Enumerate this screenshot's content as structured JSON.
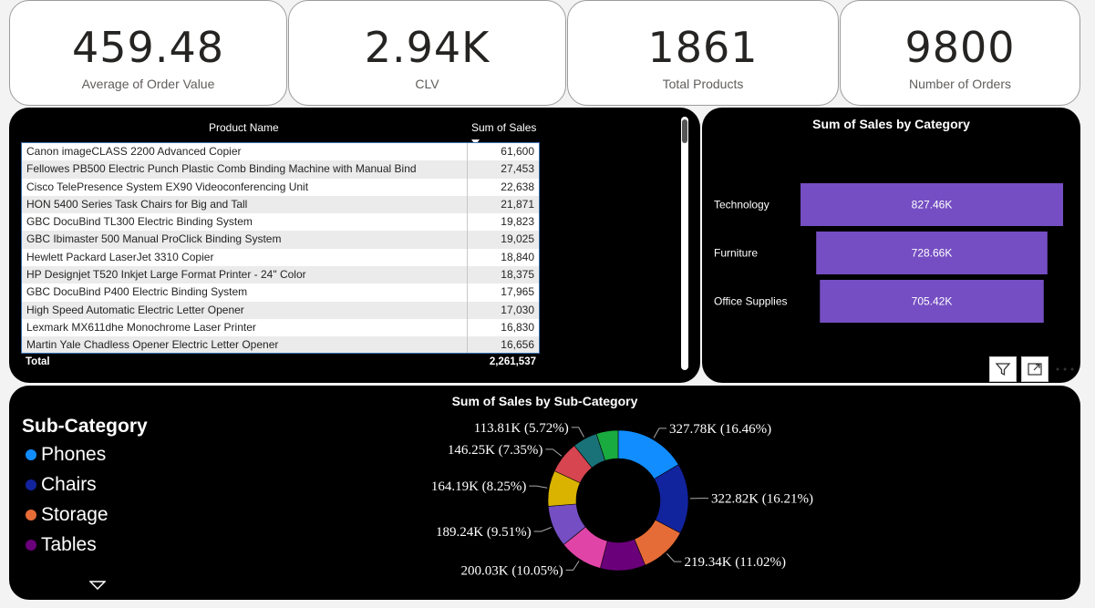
{
  "kpis": [
    {
      "value": "459.48",
      "label": "Average of Order Value"
    },
    {
      "value": "2.94K",
      "label": "CLV"
    },
    {
      "value": "1861",
      "label": "Total Products"
    },
    {
      "value": "9800",
      "label": "Number of Orders"
    }
  ],
  "table": {
    "col1": "Product Name",
    "col2": "Sum of Sales",
    "rows": [
      {
        "name": "Canon imageCLASS 2200 Advanced Copier",
        "sales": "61,600"
      },
      {
        "name": "Fellowes PB500 Electric Punch Plastic Comb Binding Machine with Manual Bind",
        "sales": "27,453"
      },
      {
        "name": "Cisco TelePresence System EX90 Videoconferencing Unit",
        "sales": "22,638"
      },
      {
        "name": "HON 5400 Series Task Chairs for Big and Tall",
        "sales": "21,871"
      },
      {
        "name": "GBC DocuBind TL300 Electric Binding System",
        "sales": "19,823"
      },
      {
        "name": "GBC Ibimaster 500 Manual ProClick Binding System",
        "sales": "19,025"
      },
      {
        "name": "Hewlett Packard LaserJet 3310 Copier",
        "sales": "18,840"
      },
      {
        "name": "HP Designjet T520 Inkjet Large Format Printer - 24\" Color",
        "sales": "18,375"
      },
      {
        "name": "GBC DocuBind P400 Electric Binding System",
        "sales": "17,965"
      },
      {
        "name": "High Speed Automatic Electric Letter Opener",
        "sales": "17,030"
      },
      {
        "name": "Lexmark MX611dhe Monochrome Laser Printer",
        "sales": "16,830"
      },
      {
        "name": "Martin Yale Chadless Opener Electric Letter Opener",
        "sales": "16,656"
      }
    ],
    "total_label": "Total",
    "total_value": "2,261,537"
  },
  "chart_data": [
    {
      "type": "bar",
      "title": "Sum of Sales by Category",
      "categories": [
        "Technology",
        "Furniture",
        "Office Supplies"
      ],
      "values": [
        827.46,
        728.66,
        705.42
      ],
      "data_labels": [
        "827.46K",
        "728.66K",
        "705.42K"
      ],
      "color": "#744ec2"
    },
    {
      "type": "pie",
      "title": "Sum of Sales by Sub-Category",
      "legend_title": "Sub-Category",
      "legend_visible": [
        "Phones",
        "Chairs",
        "Storage",
        "Tables"
      ],
      "slices": [
        {
          "name": "Phones",
          "value": 327.78,
          "pct": 16.46,
          "label": "327.78K (16.46%)",
          "color": "#118dff"
        },
        {
          "name": "Chairs",
          "value": 322.82,
          "pct": 16.21,
          "label": "322.82K (16.21%)",
          "color": "#12239e"
        },
        {
          "name": "Storage",
          "value": 219.34,
          "pct": 11.02,
          "label": "219.34K (11.02%)",
          "color": "#e66c37"
        },
        {
          "name": "Tables",
          "value": 206.97,
          "pct": 10.39,
          "label": "",
          "color": "#6b007b"
        },
        {
          "name": "",
          "value": 200.03,
          "pct": 10.05,
          "label": "200.03K (10.05%)",
          "color": "#e044a7"
        },
        {
          "name": "",
          "value": 189.24,
          "pct": 9.51,
          "label": "189.24K (9.51%)",
          "color": "#744ec2"
        },
        {
          "name": "",
          "value": 164.19,
          "pct": 8.25,
          "label": "164.19K (8.25%)",
          "color": "#d9b300"
        },
        {
          "name": "",
          "value": 146.25,
          "pct": 7.35,
          "label": "146.25K (7.35%)",
          "color": "#d64550"
        },
        {
          "name": "",
          "value": 113.81,
          "pct": 5.72,
          "label": "113.81K (5.72%)",
          "color": "#197278"
        },
        {
          "name": "",
          "value": 100.0,
          "pct": 5.04,
          "label": "",
          "color": "#1aab40"
        }
      ]
    }
  ]
}
